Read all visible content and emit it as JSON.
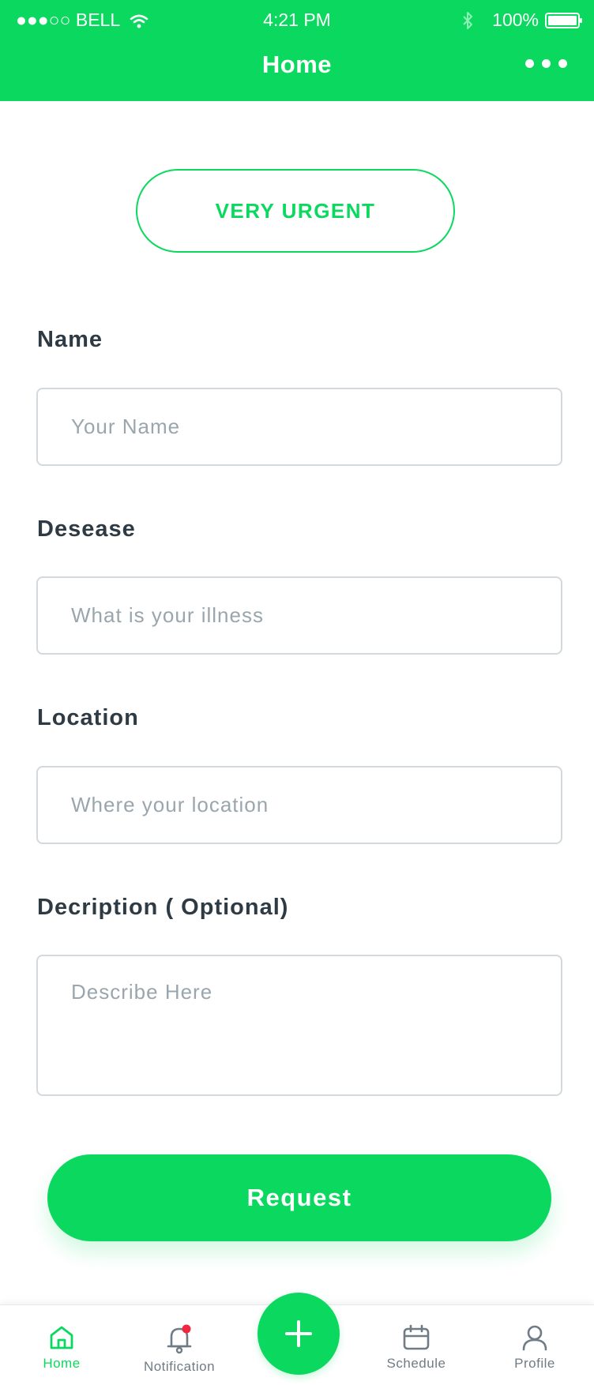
{
  "status_bar": {
    "carrier": "●●●○○ BELL",
    "time": "4:21 PM",
    "battery": "100%"
  },
  "header": {
    "title": "Home"
  },
  "urgency_button": {
    "label": "VERY URGENT"
  },
  "form": {
    "name": {
      "label": "Name",
      "placeholder": "Your Name"
    },
    "disease": {
      "label": "Desease",
      "placeholder": "What is your illness"
    },
    "location": {
      "label": "Location",
      "placeholder": "Where your location"
    },
    "description": {
      "label": "Decription ( Optional)",
      "placeholder": "Describe Here"
    }
  },
  "request_button": {
    "label": "Request"
  },
  "tabbar": {
    "home": "Home",
    "notification": "Notification",
    "schedule": "Schedule",
    "profile": "Profile"
  },
  "colors": {
    "accent": "#0bd95f",
    "text": "#2f3b44",
    "placeholder": "#9aa6ad",
    "badge": "#f0273e"
  }
}
